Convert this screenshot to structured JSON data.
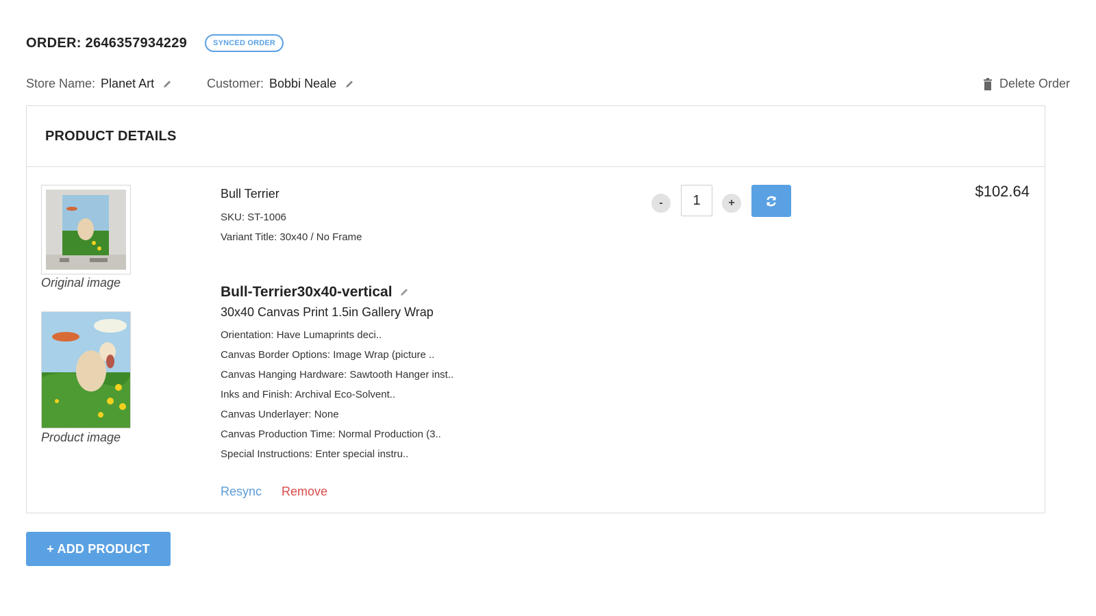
{
  "order": {
    "title": "ORDER: 2646357934229",
    "badge": "SYNCED ORDER",
    "store_label": "Store Name:",
    "store_value": "Planet Art",
    "customer_label": "Customer:",
    "customer_value": "Bobbi Neale",
    "delete_label": "Delete Order"
  },
  "panel": {
    "title": "PRODUCT DETAILS"
  },
  "product": {
    "original_caption": "Original image",
    "product_caption": "Product image",
    "name": "Bull Terrier",
    "sku": "SKU: ST-1006",
    "variant": "Variant Title: 30x40 / No Frame",
    "design_title": "Bull-Terrier30x40-vertical",
    "design_subtitle": "30x40 Canvas Print 1.5in Gallery Wrap",
    "options": [
      "Orientation: Have Lumaprints deci..",
      "Canvas Border Options: Image Wrap (picture ..",
      "Canvas Hanging Hardware: Sawtooth Hanger inst..",
      "Inks and Finish: Archival Eco-Solvent..",
      "Canvas Underlayer: None",
      "Canvas Production Time: Normal Production (3..",
      "Special Instructions: Enter special instru.."
    ],
    "resync_label": "Resync",
    "remove_label": "Remove",
    "qty_minus": "-",
    "qty_plus": "+",
    "quantity": "1",
    "price": "$102.64"
  },
  "actions": {
    "add_product": "+ ADD PRODUCT"
  },
  "colors": {
    "accent": "#5aa1e3",
    "link_blue": "#5b9bd8",
    "remove_red": "#d84b4b"
  }
}
